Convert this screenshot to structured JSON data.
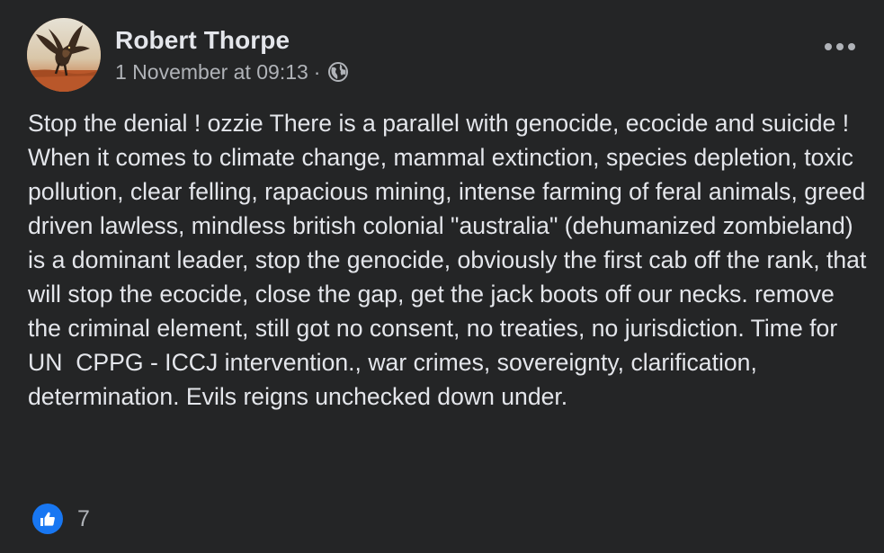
{
  "post": {
    "author": "Robert Thorpe",
    "timestamp": "1 November at 09:13",
    "separator": "·",
    "audience_icon": "globe-icon",
    "menu_icon": "more-options-icon",
    "text": "Stop the denial ! ozzie There is a parallel with genocide, ecocide and suicide !  When it comes to climate change, mammal extinction, species depletion, toxic pollution, clear felling, rapacious mining, intense farming of feral animals, greed driven lawless, mindless british colonial \"australia\" (dehumanized zombieland) is a dominant leader, stop the genocide, obviously the first cab off the rank, that will stop the ecocide, close the gap, get the jack boots off our necks. remove the criminal element, still got no consent, no treaties, no jurisdiction. Time for UN  CPPG - ICCJ intervention., war crimes, sovereignty, clarification, determination. Evils reigns unchecked down under.",
    "reactions": {
      "icon": "like-icon",
      "count": "7"
    }
  },
  "colors": {
    "background": "#242526",
    "primary_text": "#e4e6eb",
    "secondary_text": "#b0b3b8",
    "like_blue": "#1877f2"
  }
}
